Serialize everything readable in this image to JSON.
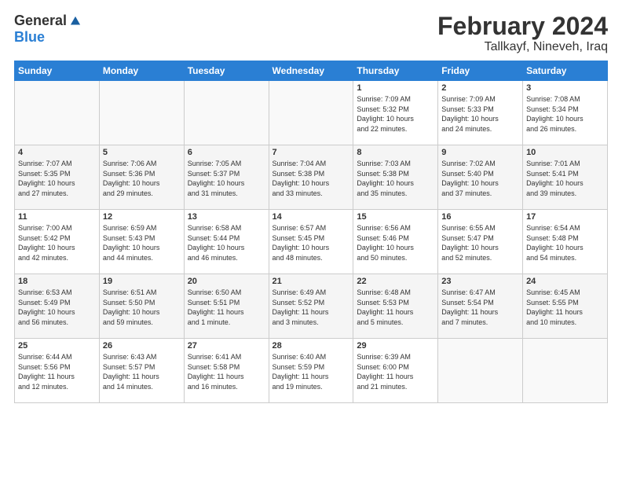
{
  "logo": {
    "general": "General",
    "blue": "Blue"
  },
  "title": "February 2024",
  "location": "Tallkayf, Nineveh, Iraq",
  "weekdays": [
    "Sunday",
    "Monday",
    "Tuesday",
    "Wednesday",
    "Thursday",
    "Friday",
    "Saturday"
  ],
  "weeks": [
    [
      {
        "day": "",
        "info": ""
      },
      {
        "day": "",
        "info": ""
      },
      {
        "day": "",
        "info": ""
      },
      {
        "day": "",
        "info": ""
      },
      {
        "day": "1",
        "info": "Sunrise: 7:09 AM\nSunset: 5:32 PM\nDaylight: 10 hours\nand 22 minutes."
      },
      {
        "day": "2",
        "info": "Sunrise: 7:09 AM\nSunset: 5:33 PM\nDaylight: 10 hours\nand 24 minutes."
      },
      {
        "day": "3",
        "info": "Sunrise: 7:08 AM\nSunset: 5:34 PM\nDaylight: 10 hours\nand 26 minutes."
      }
    ],
    [
      {
        "day": "4",
        "info": "Sunrise: 7:07 AM\nSunset: 5:35 PM\nDaylight: 10 hours\nand 27 minutes."
      },
      {
        "day": "5",
        "info": "Sunrise: 7:06 AM\nSunset: 5:36 PM\nDaylight: 10 hours\nand 29 minutes."
      },
      {
        "day": "6",
        "info": "Sunrise: 7:05 AM\nSunset: 5:37 PM\nDaylight: 10 hours\nand 31 minutes."
      },
      {
        "day": "7",
        "info": "Sunrise: 7:04 AM\nSunset: 5:38 PM\nDaylight: 10 hours\nand 33 minutes."
      },
      {
        "day": "8",
        "info": "Sunrise: 7:03 AM\nSunset: 5:38 PM\nDaylight: 10 hours\nand 35 minutes."
      },
      {
        "day": "9",
        "info": "Sunrise: 7:02 AM\nSunset: 5:40 PM\nDaylight: 10 hours\nand 37 minutes."
      },
      {
        "day": "10",
        "info": "Sunrise: 7:01 AM\nSunset: 5:41 PM\nDaylight: 10 hours\nand 39 minutes."
      }
    ],
    [
      {
        "day": "11",
        "info": "Sunrise: 7:00 AM\nSunset: 5:42 PM\nDaylight: 10 hours\nand 42 minutes."
      },
      {
        "day": "12",
        "info": "Sunrise: 6:59 AM\nSunset: 5:43 PM\nDaylight: 10 hours\nand 44 minutes."
      },
      {
        "day": "13",
        "info": "Sunrise: 6:58 AM\nSunset: 5:44 PM\nDaylight: 10 hours\nand 46 minutes."
      },
      {
        "day": "14",
        "info": "Sunrise: 6:57 AM\nSunset: 5:45 PM\nDaylight: 10 hours\nand 48 minutes."
      },
      {
        "day": "15",
        "info": "Sunrise: 6:56 AM\nSunset: 5:46 PM\nDaylight: 10 hours\nand 50 minutes."
      },
      {
        "day": "16",
        "info": "Sunrise: 6:55 AM\nSunset: 5:47 PM\nDaylight: 10 hours\nand 52 minutes."
      },
      {
        "day": "17",
        "info": "Sunrise: 6:54 AM\nSunset: 5:48 PM\nDaylight: 10 hours\nand 54 minutes."
      }
    ],
    [
      {
        "day": "18",
        "info": "Sunrise: 6:53 AM\nSunset: 5:49 PM\nDaylight: 10 hours\nand 56 minutes."
      },
      {
        "day": "19",
        "info": "Sunrise: 6:51 AM\nSunset: 5:50 PM\nDaylight: 10 hours\nand 59 minutes."
      },
      {
        "day": "20",
        "info": "Sunrise: 6:50 AM\nSunset: 5:51 PM\nDaylight: 11 hours\nand 1 minute."
      },
      {
        "day": "21",
        "info": "Sunrise: 6:49 AM\nSunset: 5:52 PM\nDaylight: 11 hours\nand 3 minutes."
      },
      {
        "day": "22",
        "info": "Sunrise: 6:48 AM\nSunset: 5:53 PM\nDaylight: 11 hours\nand 5 minutes."
      },
      {
        "day": "23",
        "info": "Sunrise: 6:47 AM\nSunset: 5:54 PM\nDaylight: 11 hours\nand 7 minutes."
      },
      {
        "day": "24",
        "info": "Sunrise: 6:45 AM\nSunset: 5:55 PM\nDaylight: 11 hours\nand 10 minutes."
      }
    ],
    [
      {
        "day": "25",
        "info": "Sunrise: 6:44 AM\nSunset: 5:56 PM\nDaylight: 11 hours\nand 12 minutes."
      },
      {
        "day": "26",
        "info": "Sunrise: 6:43 AM\nSunset: 5:57 PM\nDaylight: 11 hours\nand 14 minutes."
      },
      {
        "day": "27",
        "info": "Sunrise: 6:41 AM\nSunset: 5:58 PM\nDaylight: 11 hours\nand 16 minutes."
      },
      {
        "day": "28",
        "info": "Sunrise: 6:40 AM\nSunset: 5:59 PM\nDaylight: 11 hours\nand 19 minutes."
      },
      {
        "day": "29",
        "info": "Sunrise: 6:39 AM\nSunset: 6:00 PM\nDaylight: 11 hours\nand 21 minutes."
      },
      {
        "day": "",
        "info": ""
      },
      {
        "day": "",
        "info": ""
      }
    ]
  ]
}
